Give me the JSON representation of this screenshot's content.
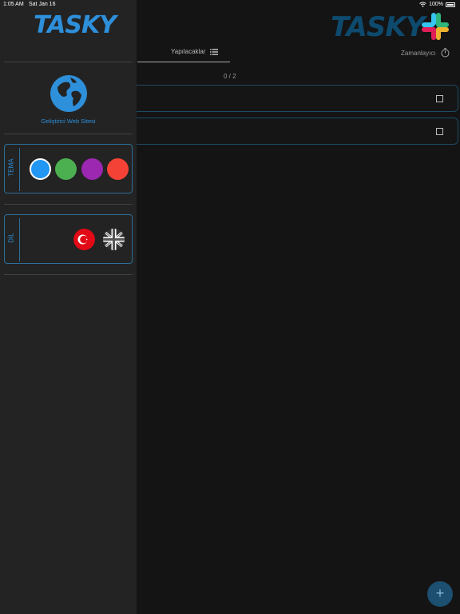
{
  "status_bar": {
    "time": "1:05 AM",
    "date": "Sat Jan 16",
    "battery": "100%"
  },
  "main": {
    "logo": "TASKY",
    "tabs": [
      {
        "label": "Yapılacaklar",
        "icon": "list-icon"
      },
      {
        "label": "Zamanlayıcı",
        "icon": "timer-icon"
      }
    ],
    "counter": "0 / 2",
    "tasks": [
      {
        "checked": false
      },
      {
        "checked": false
      }
    ],
    "fab_label": "+"
  },
  "drawer": {
    "logo": "TASKY",
    "website_icon": "globe-icon",
    "website_label": "Geliştirici Web Sitesi",
    "theme": {
      "label": "TEMA",
      "colors": [
        "#2196f3",
        "#4caf50",
        "#9c27b0",
        "#f44336"
      ],
      "selected_index": 0
    },
    "language": {
      "label": "DİL",
      "options": [
        {
          "name": "Türkçe",
          "icon": "turkey-flag-icon"
        },
        {
          "name": "English",
          "icon": "uk-flag-icon"
        }
      ]
    }
  }
}
